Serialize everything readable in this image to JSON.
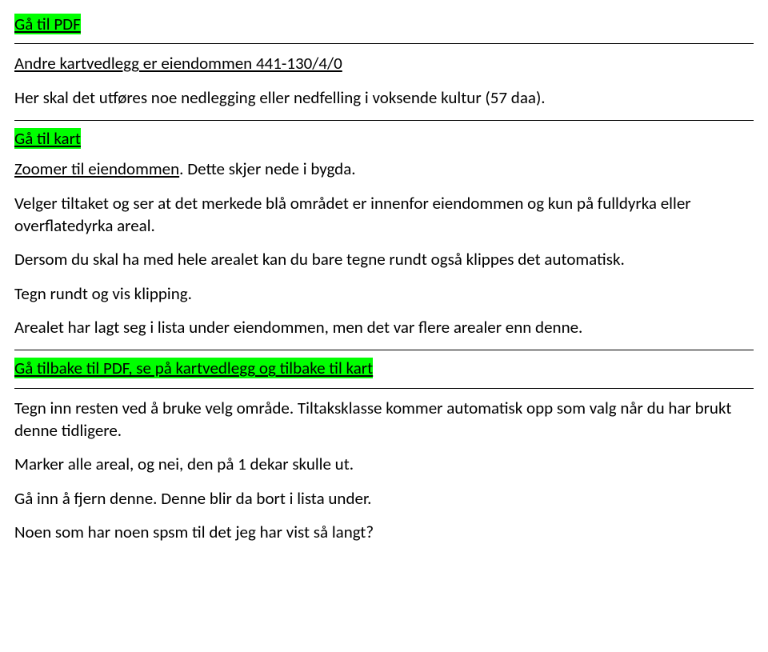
{
  "link_pdf": "Gå til PDF",
  "heading_other_attachments": "Andre kartvedlegg er eiendommen 441-130/4/0",
  "p_intro": "Her skal det utføres noe nedlegging eller nedfelling i voksende kultur (57 daa).",
  "link_map": "Gå til kart",
  "p_zoom_part1": "Zoomer til eiendommen",
  "p_zoom_part2": ". Dette skjer nede i bygda.",
  "p_velger": "Velger tiltaket og ser at det merkede blå området er innenfor eiendommen og kun på fulldyrka eller overflatedyrka areal.",
  "p_dersom": "Dersom du skal ha med hele arealet kan du bare tegne rundt også klippes det automatisk.",
  "p_tegn": "Tegn rundt og vis klipping.",
  "p_arealet": "Arealet har lagt seg i lista under eiendommen, men det var flere arealer enn denne.",
  "link_back": "Gå tilbake til PDF, se på kartvedlegg og tilbake til kart",
  "p_tegn_inn": "Tegn inn resten ved å bruke velg område. Tiltaksklasse kommer automatisk opp som valg når du har brukt denne tidligere.",
  "p_marker": "Marker alle areal, og nei, den på 1 dekar skulle ut.",
  "p_gaa_inn": "Gå inn å fjern denne. Denne blir da bort i lista under.",
  "p_noen": "Noen som har noen spsm til det jeg har vist så langt?"
}
